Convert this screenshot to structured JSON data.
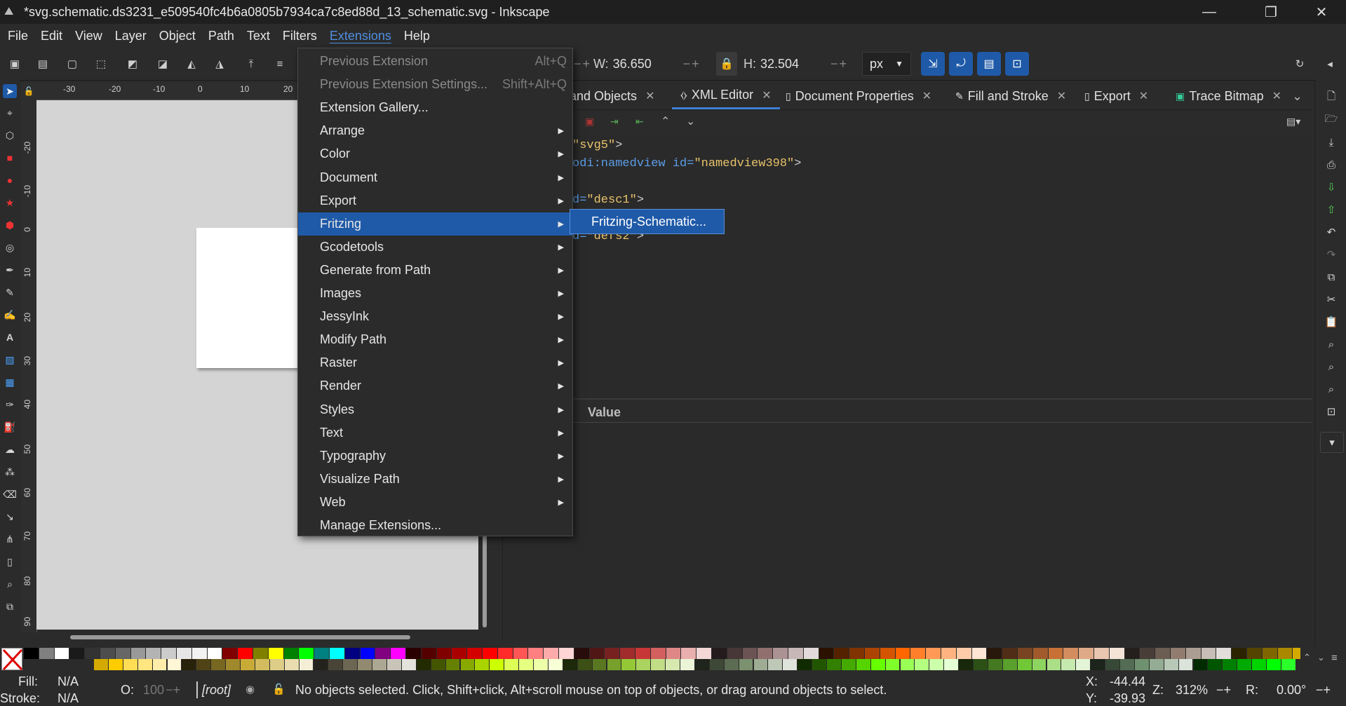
{
  "window": {
    "title": "*svg.schematic.ds3231_e509540fc4b6a0805b7934ca7c8ed88d_13_schematic.svg - Inkscape",
    "minimize": "—",
    "maximize": "❐",
    "close": "✕"
  },
  "menubar": [
    "File",
    "Edit",
    "View",
    "Layer",
    "Object",
    "Path",
    "Text",
    "Filters",
    "Extensions",
    "Help"
  ],
  "toolbar": {
    "w_label": "W:",
    "w_value": "36.650",
    "h_label": "H:",
    "h_value": "32.504",
    "unit": "px",
    "minus": "−",
    "plus": "+"
  },
  "extensions_menu": [
    {
      "label": "Previous Extension",
      "accel": "Alt+Q",
      "disabled": true
    },
    {
      "label": "Previous Extension Settings...",
      "accel": "Shift+Alt+Q",
      "disabled": true
    },
    {
      "label": "Extension Gallery..."
    },
    {
      "label": "Arrange",
      "submenu": true
    },
    {
      "label": "Color",
      "submenu": true
    },
    {
      "label": "Document",
      "submenu": true
    },
    {
      "label": "Export",
      "submenu": true
    },
    {
      "label": "Fritzing",
      "submenu": true,
      "highlighted": true
    },
    {
      "label": "Gcodetools",
      "submenu": true
    },
    {
      "label": "Generate from Path",
      "submenu": true
    },
    {
      "label": "Images",
      "submenu": true
    },
    {
      "label": "JessyInk",
      "submenu": true
    },
    {
      "label": "Modify Path",
      "submenu": true
    },
    {
      "label": "Raster",
      "submenu": true
    },
    {
      "label": "Render",
      "submenu": true
    },
    {
      "label": "Styles",
      "submenu": true
    },
    {
      "label": "Text",
      "submenu": true
    },
    {
      "label": "Typography",
      "submenu": true
    },
    {
      "label": "Visualize Path",
      "submenu": true
    },
    {
      "label": "Web",
      "submenu": true
    },
    {
      "label": "Manage Extensions..."
    }
  ],
  "fritzing_submenu": {
    "item": "Fritzing-Schematic..."
  },
  "dock_tabs": [
    {
      "label": "and Objects",
      "active": false
    },
    {
      "label": "XML Editor",
      "active": true
    },
    {
      "label": "Document Properties",
      "active": false
    },
    {
      "label": "Fill and Stroke",
      "active": false
    },
    {
      "label": "Export",
      "active": false
    },
    {
      "label": "Trace Bitmap",
      "active": false
    }
  ],
  "xml_tree": [
    {
      "parts": [
        [
          "str",
          "\"svg5\""
        ],
        [
          "pun",
          ">"
        ]
      ]
    },
    {
      "parts": [
        [
          "kw",
          "odi:namedview "
        ],
        [
          "kw",
          "id="
        ],
        [
          "str",
          "\"namedview398\""
        ],
        [
          "pun",
          ">"
        ]
      ]
    },
    {
      "parts": []
    },
    {
      "parts": [
        [
          "kw",
          "d="
        ],
        [
          "str",
          "\"desc1\""
        ],
        [
          "pun",
          ">"
        ]
      ]
    },
    {
      "parts": []
    },
    {
      "parts": [
        [
          "kw",
          "d="
        ],
        [
          "str",
          "\"defs2\""
        ],
        [
          "pun",
          ">"
        ]
      ]
    }
  ],
  "attr_panel": {
    "value_header": "Value"
  },
  "rulers": {
    "h_ticks": [
      "-30",
      "-20",
      "-10",
      "0",
      "10",
      "20"
    ],
    "v_ticks": [
      "-20",
      "-10",
      "0",
      "10",
      "20",
      "30",
      "40",
      "50",
      "60",
      "70",
      "80",
      "90"
    ]
  },
  "statusbar": {
    "fill_label": "Fill:",
    "fill_value": "N/A",
    "stroke_label": "Stroke:",
    "stroke_value": "N/A",
    "opacity_label": "O:",
    "opacity_value": "100",
    "layer": "[root]",
    "message": "No objects selected. Click, Shift+click, Alt+scroll mouse on top of objects, or drag around objects to select.",
    "x_label": "X:",
    "x_value": "-44.44",
    "y_label": "Y:",
    "y_value": "-39.93",
    "zoom_label": "Z:",
    "zoom_value": "312%",
    "rot_label": "R:",
    "rot_value": "0.00°"
  },
  "palette_top": [
    "#000000",
    "#808080",
    "#ffffff",
    "#1a1a1a",
    "#333333",
    "#4d4d4d",
    "#666666",
    "#999999",
    "#b3b3b3",
    "#cccccc",
    "#e6e6e6",
    "#f2f2f2",
    "#ffffff",
    "#800000",
    "#ff0000",
    "#808000",
    "#ffff00",
    "#008000",
    "#00ff00",
    "#008080",
    "#00ffff",
    "#000080",
    "#0000ff",
    "#800080",
    "#ff00ff",
    "#2b0000",
    "#550000",
    "#800000",
    "#aa0000",
    "#d40000",
    "#ff0000",
    "#ff2a2a",
    "#ff5555",
    "#ff8080",
    "#ffaaaa",
    "#ffd5d5",
    "#280b0b",
    "#501616",
    "#782121",
    "#a02c2c",
    "#c83737",
    "#d35f5f",
    "#de8787",
    "#e9afaf",
    "#f4d7d7",
    "#241c1c",
    "#483737",
    "#6c5353",
    "#916f6f",
    "#ac9393",
    "#c8b7b7",
    "#e3dbdb",
    "#2b1100",
    "#552200",
    "#803300",
    "#aa4400",
    "#d45500",
    "#ff6600",
    "#ff7f2a",
    "#ff9955",
    "#ffb380",
    "#ffccaa",
    "#ffe6d5",
    "#28170b",
    "#502d16",
    "#784421",
    "#a05a2c",
    "#c87137",
    "#d38d5f",
    "#deaa87",
    "#e9c6af",
    "#f4e3d7",
    "#241f1c",
    "#483e37",
    "#6c5d53",
    "#917c6f",
    "#ac9d93",
    "#c8beb7",
    "#e3dedb",
    "#2b2200",
    "#554400",
    "#806600",
    "#aa8800",
    "#d4aa00",
    "#ffcc00"
  ],
  "palette_bottom": [
    "#d4aa00",
    "#ffcc00",
    "#ffdd55",
    "#ffe680",
    "#ffeeaa",
    "#fff6d5",
    "#28220b",
    "#504416",
    "#786721",
    "#a0892c",
    "#c8ab37",
    "#d3bc5f",
    "#decd87",
    "#e9ddaf",
    "#f4eed7",
    "#24221c",
    "#484537",
    "#6c6753",
    "#918a6f",
    "#aca793",
    "#c8c4b7",
    "#e3e2db",
    "#222b00",
    "#445500",
    "#668000",
    "#88aa00",
    "#aad400",
    "#ccff00",
    "#ddff55",
    "#e5ff80",
    "#eeffaa",
    "#f6ffd5",
    "#1e280b",
    "#3c5016",
    "#5a7821",
    "#77a02c",
    "#94c837",
    "#abd35f",
    "#c1de87",
    "#d6e9af",
    "#ebf4d7",
    "#1f241c",
    "#3e4837",
    "#5c6c53",
    "#7b916f",
    "#9eac93",
    "#bec8b7",
    "#dee3db",
    "#112b00",
    "#225500",
    "#338000",
    "#44aa00",
    "#55d400",
    "#66ff00",
    "#7fff2a",
    "#99ff55",
    "#b3ff80",
    "#ccffaa",
    "#e5ffd5",
    "#17280b",
    "#2d5016",
    "#447821",
    "#5aa02c",
    "#71c837",
    "#8dd35f",
    "#aade87",
    "#c6e9af",
    "#e3f4d7",
    "#1c241c",
    "#374837",
    "#536c53",
    "#6f916f",
    "#93ac93",
    "#b7c8b7",
    "#dbe3db",
    "#002b00",
    "#005500",
    "#008000",
    "#00aa00",
    "#00d400",
    "#00ff00",
    "#2aff2a"
  ],
  "colors": {
    "accent": "#1f5aa8",
    "menu_active": "#4f8fdf",
    "xml_string": "#e8c36b",
    "xml_attr": "#5b9ee8"
  }
}
